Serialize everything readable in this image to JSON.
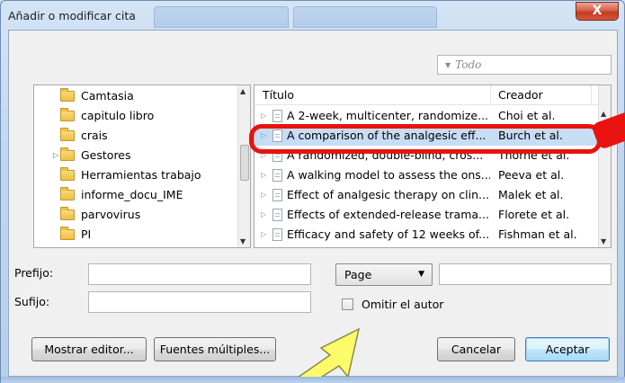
{
  "window": {
    "title": "Añadir o modificar cita",
    "close_glyph": "X"
  },
  "search": {
    "placeholder": "Todo"
  },
  "collections": {
    "items": [
      {
        "label": "Camtasia",
        "expandable": false
      },
      {
        "label": "capitulo libro",
        "expandable": false
      },
      {
        "label": "crais",
        "expandable": false
      },
      {
        "label": "Gestores",
        "expandable": true
      },
      {
        "label": "Herramientas trabajo",
        "expandable": false
      },
      {
        "label": "informe_docu_IME",
        "expandable": false
      },
      {
        "label": "parvovirus",
        "expandable": false
      },
      {
        "label": "PI",
        "expandable": false
      }
    ]
  },
  "items_table": {
    "columns": {
      "title": "Título",
      "creator": "Creador"
    },
    "rows": [
      {
        "title": "A 2-week, multicenter, randomize...",
        "creator": "Choi et al.",
        "selected": false
      },
      {
        "title": "A comparison of the analgesic eff...",
        "creator": "Burch et al.",
        "selected": true
      },
      {
        "title": "A randomized, double-blind, cros...",
        "creator": "Thorne et al.",
        "selected": false
      },
      {
        "title": "A walking model to assess the ons...",
        "creator": "Peeva et al.",
        "selected": false
      },
      {
        "title": "Effect of analgesic therapy on clin...",
        "creator": "Malek et al.",
        "selected": false
      },
      {
        "title": "Effects of extended-release trama...",
        "creator": "Florete et al.",
        "selected": false
      },
      {
        "title": "Efficacy and safety of 12 weeks of...",
        "creator": "Fishman et al.",
        "selected": false
      }
    ]
  },
  "form": {
    "prefix_label": "Prefijo:",
    "prefix_value": "",
    "suffix_label": "Sufijo:",
    "suffix_value": "",
    "locator_type": "Page",
    "locator_value": "",
    "omit_author_label": "Omitir el autor",
    "omit_author_checked": false
  },
  "buttons": {
    "show_editor": "Mostrar editor...",
    "multiple_sources": "Fuentes múltiples...",
    "cancel": "Cancelar",
    "accept": "Aceptar"
  },
  "annotation_colors": {
    "highlight": "#e8130f",
    "arrow": "#fdfb6a"
  }
}
